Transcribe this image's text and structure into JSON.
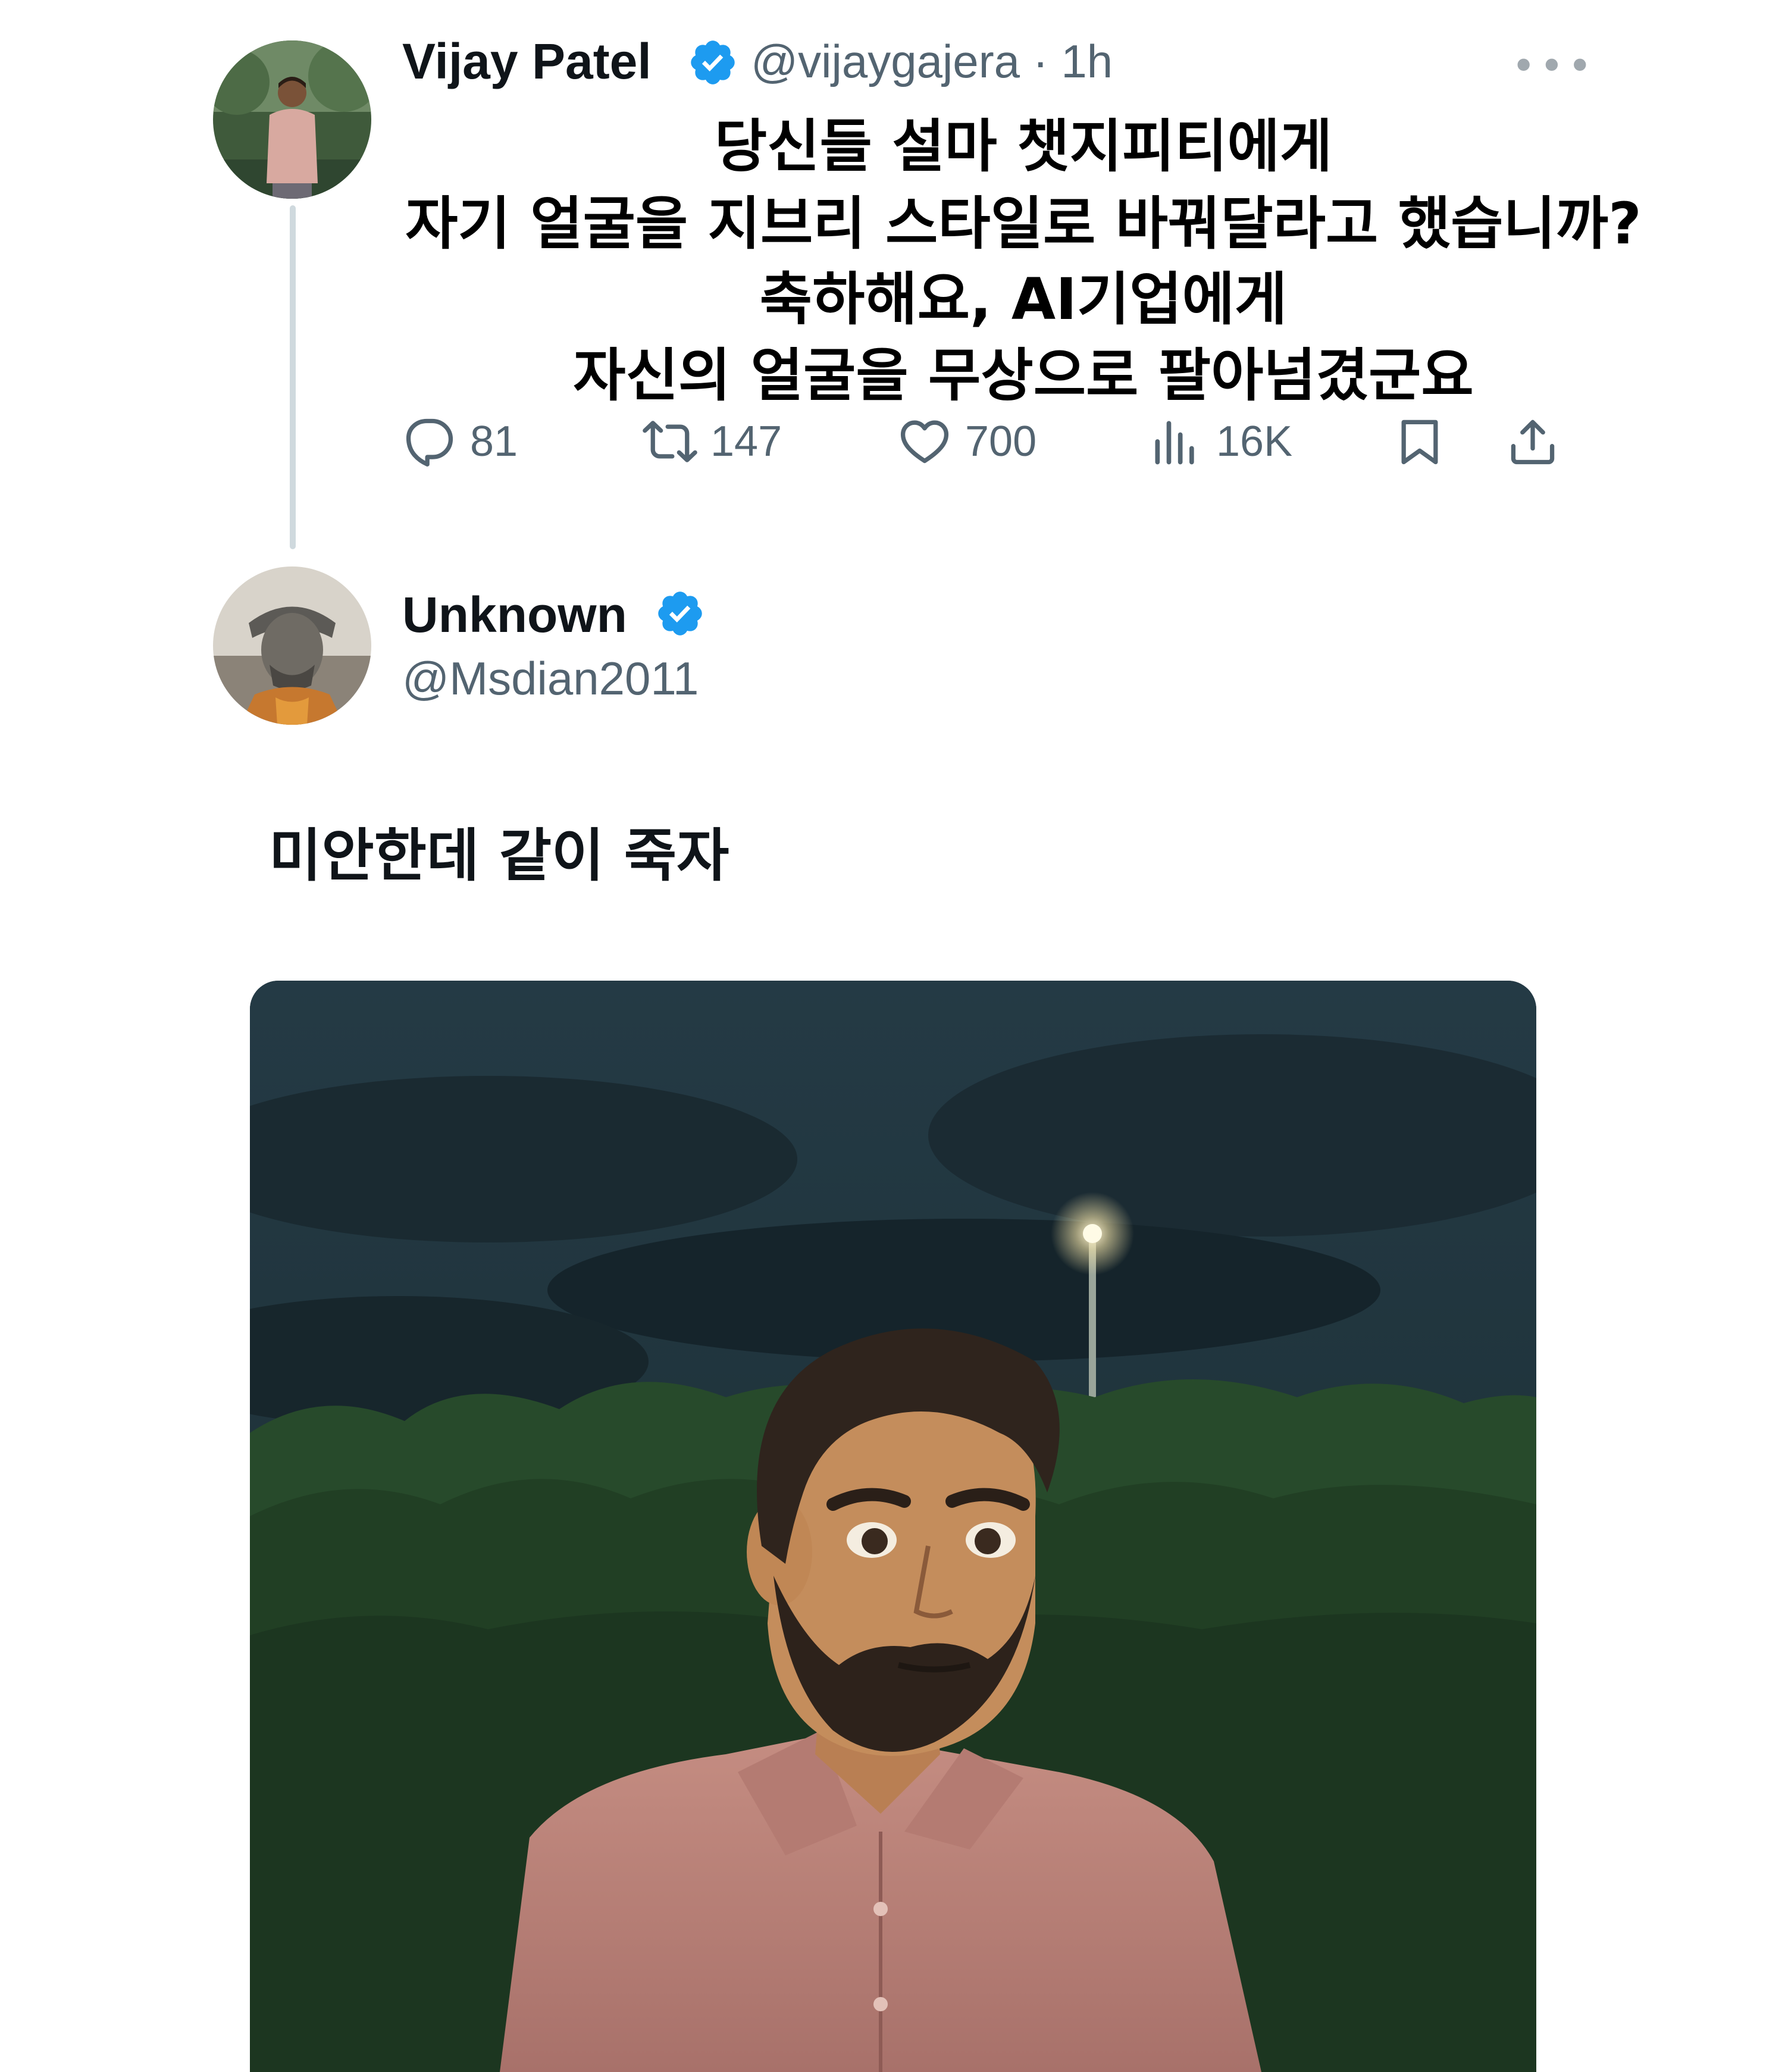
{
  "tweet1": {
    "author": {
      "name": "Vijay Patel",
      "handle_time": "@vijaygajera · 1h",
      "verified": true,
      "avatar_icon": "user-photo-avatar"
    },
    "more_icon": "more-dots-icon",
    "caption_lines": [
      "당신들 설마 챗지피티에게",
      "자기 얼굴을 지브리 스타일로 바꿔달라고 했습니까?",
      "축하해요, AI기업에게",
      "자신의 얼굴을 무상으로 팔아넘겼군요"
    ],
    "actions": {
      "replies": "81",
      "reposts": "147",
      "likes": "700",
      "views": "16K",
      "bookmark_icon": "bookmark-icon",
      "share_icon": "share-icon"
    }
  },
  "tweet2": {
    "author": {
      "name": "Unknown",
      "handle": "@Msdian2011",
      "verified": true,
      "avatar_icon": "statue-avatar"
    },
    "text": "미안한데 같이 죽자",
    "media_icon": "ghibli-style-portrait-image"
  },
  "colors": {
    "verified_blue": "#1d9bf0",
    "text_primary": "#0f1419",
    "text_secondary": "#536471",
    "thread_line": "#cfd9de"
  }
}
